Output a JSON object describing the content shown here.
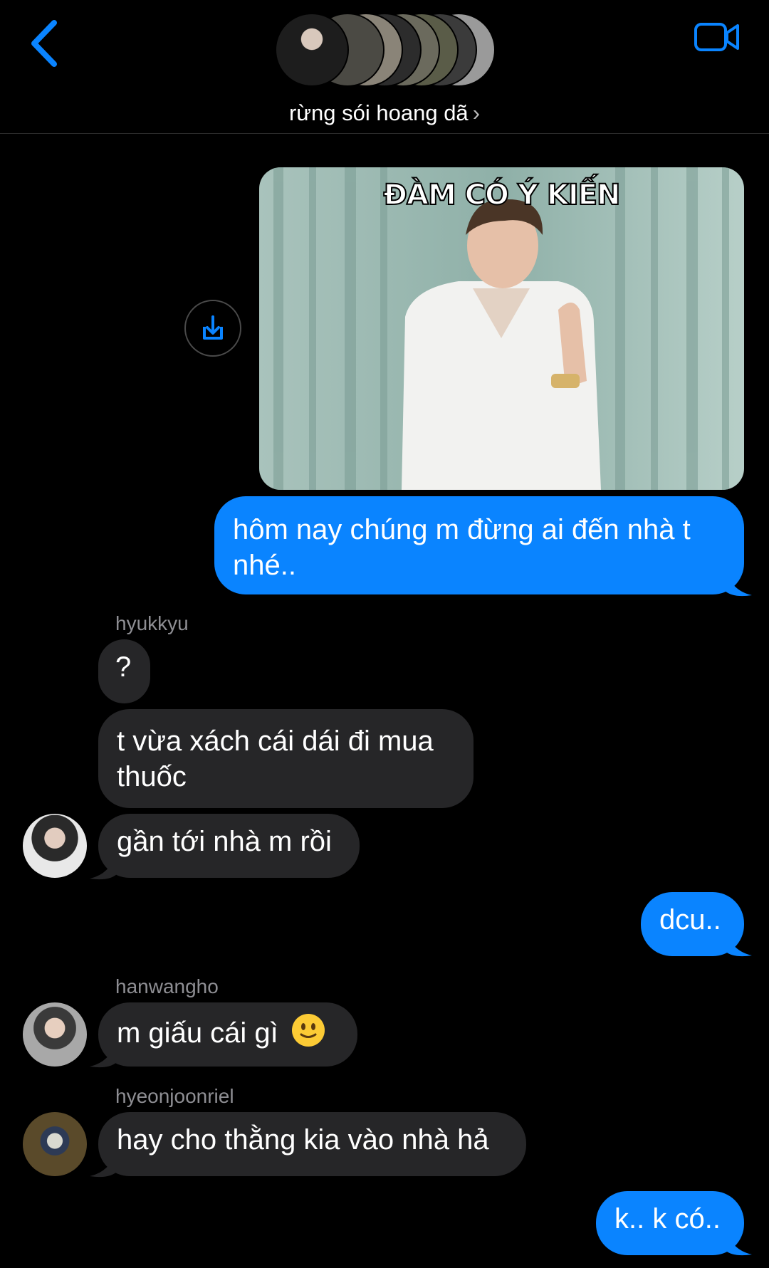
{
  "header": {
    "group_name": "rừng sói hoang dã",
    "chevron": "›"
  },
  "media": {
    "caption": "ĐÀM CÓ Ý KIẾN"
  },
  "messages": {
    "m1": "hôm nay chúng m đừng ai đến nhà t nhé..",
    "m2_sender": "hyukkyu",
    "m2": "?",
    "m3": "t vừa xách cái dái đi mua thuốc",
    "m4": "gần tới nhà m rồi",
    "m5": "dcu..",
    "m6_sender": "hanwangho",
    "m6": "m giấu cái gì",
    "m7_sender": "hyeonjoonriel",
    "m7": "hay cho thằng kia vào nhà hả",
    "m8": "k.. k có.."
  },
  "colors": {
    "accent": "#0a84ff",
    "incoming_bubble": "#262628",
    "background": "#000000"
  },
  "icons": [
    "back-chevron-icon",
    "video-call-icon",
    "download-icon",
    "smile-emoji-icon"
  ]
}
